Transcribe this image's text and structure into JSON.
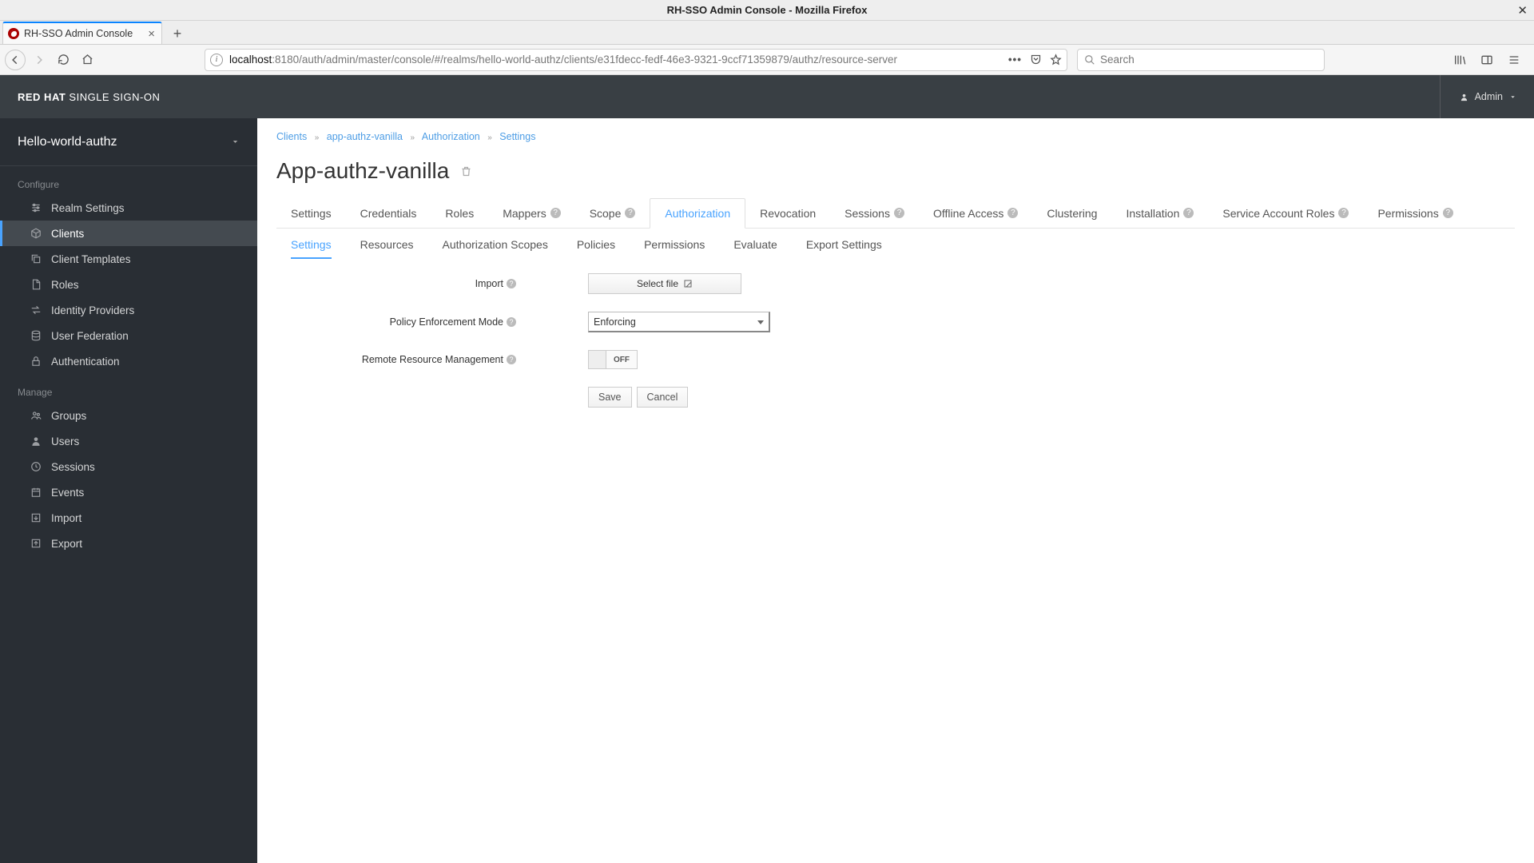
{
  "window": {
    "title": "RH-SSO Admin Console - Mozilla Firefox",
    "tab_label": "RH-SSO Admin Console"
  },
  "url": {
    "host": "localhost",
    "rest": ":8180/auth/admin/master/console/#/realms/hello-world-authz/clients/e31fdecc-fedf-46e3-9321-9ccf71359879/authz/resource-server",
    "search_placeholder": "Search"
  },
  "header": {
    "brand_bold": "RED HAT",
    "brand_light": " SINGLE SIGN-ON",
    "user": "Admin"
  },
  "sidebar": {
    "realm": "Hello-world-authz",
    "group_configure": "Configure",
    "group_manage": "Manage",
    "configure": [
      {
        "icon": "sliders",
        "label": "Realm Settings"
      },
      {
        "icon": "cube",
        "label": "Clients"
      },
      {
        "icon": "copy",
        "label": "Client Templates"
      },
      {
        "icon": "file",
        "label": "Roles"
      },
      {
        "icon": "exchange",
        "label": "Identity Providers"
      },
      {
        "icon": "db",
        "label": "User Federation"
      },
      {
        "icon": "lock",
        "label": "Authentication"
      }
    ],
    "manage": [
      {
        "icon": "group",
        "label": "Groups"
      },
      {
        "icon": "user",
        "label": "Users"
      },
      {
        "icon": "clock",
        "label": "Sessions"
      },
      {
        "icon": "cal",
        "label": "Events"
      },
      {
        "icon": "in",
        "label": "Import"
      },
      {
        "icon": "out",
        "label": "Export"
      }
    ]
  },
  "crumbs": {
    "c1": "Clients",
    "c2": "app-authz-vanilla",
    "c3": "Authorization",
    "c4": "Settings"
  },
  "page": {
    "title": "App-authz-vanilla"
  },
  "tabs": {
    "settings": "Settings",
    "credentials": "Credentials",
    "roles": "Roles",
    "mappers": "Mappers",
    "scope": "Scope",
    "authorization": "Authorization",
    "revocation": "Revocation",
    "sessions": "Sessions",
    "offline": "Offline Access",
    "clustering": "Clustering",
    "installation": "Installation",
    "sar": "Service Account Roles",
    "permissions": "Permissions"
  },
  "subtabs": {
    "settings": "Settings",
    "resources": "Resources",
    "scopes": "Authorization Scopes",
    "policies": "Policies",
    "permissions": "Permissions",
    "evaluate": "Evaluate",
    "export": "Export Settings"
  },
  "form": {
    "import_label": "Import",
    "select_file": "Select file",
    "pem_label": "Policy Enforcement Mode",
    "pem_value": "Enforcing",
    "rrm_label": "Remote Resource Management",
    "rrm_state": "OFF",
    "save": "Save",
    "cancel": "Cancel"
  }
}
